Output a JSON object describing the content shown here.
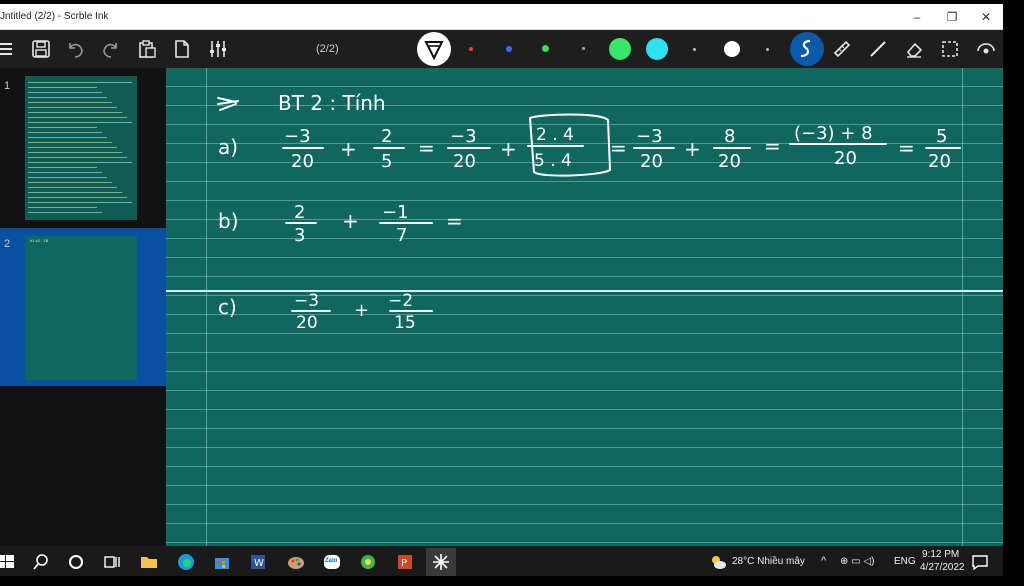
{
  "window": {
    "title": "Jntitled (2/2) - Scrble Ink",
    "minimize_glyph": "–",
    "restore_glyph": "❐",
    "close_glyph": "✕"
  },
  "toolbar": {
    "page_count": "(2/2)",
    "icons": [
      "menu-icon",
      "save-icon",
      "undo-icon",
      "redo-icon",
      "clipboard-icon",
      "new-page-icon",
      "settings-sliders-icon",
      "pen-mode-icon",
      "ruler-icon",
      "line-icon",
      "eraser-icon",
      "select-icon",
      "view-icon"
    ],
    "pen_colors": [
      "#ff3b3b",
      "#3b6bff",
      "#3be05a",
      "#aaaaaa",
      "#39e56a",
      "#2ee0f0",
      "#bbbbbb",
      "#ffffff",
      "#bbbbbb"
    ],
    "active_tool_color": "#0a5aa8"
  },
  "sidebar": {
    "pages": [
      {
        "number": "1"
      },
      {
        "number": "2",
        "selected": true
      }
    ],
    "thumb2_label": "b1  b2 : 1B"
  },
  "canvas": {
    "background": "#0f6760",
    "heading": "BT 2 : Tính",
    "a_label": "a)",
    "a_num1": "−3",
    "a_den1": "20",
    "a_op1": "+",
    "a_num2": "2",
    "a_den2": "5",
    "a_eq1": "=",
    "a_num3": "−3",
    "a_den3": "20",
    "a_op2": "+",
    "a_num4": "2 . 4",
    "a_den4": "5 . 4",
    "a_eq2": "=",
    "a_num5": "−3",
    "a_den5": "20",
    "a_op3": "+",
    "a_num6": "8",
    "a_den6": "20",
    "a_eq3": "=",
    "a_num7": "(−3) + 8",
    "a_den7": "20",
    "a_eq4": "=",
    "a_num8": "5",
    "a_den8": "20",
    "b_label": "b)",
    "b_num1": "2",
    "b_den1": "3",
    "b_op1": "+",
    "b_num2": "−1",
    "b_den2": "7",
    "b_eq1": "=",
    "c_label": "c)",
    "c_num1": "−3",
    "c_den1": "20",
    "c_op1": "+",
    "c_num2": "−2",
    "c_den2": "15"
  },
  "taskbar": {
    "apps": [
      "windows-icon",
      "search-icon",
      "cortana-icon",
      "task-view-icon",
      "file-explorer-icon",
      "edge-icon",
      "store-icon",
      "word-icon",
      "paint-icon",
      "zalo-icon",
      "app-icon",
      "powerpoint-icon",
      "scrble-ink-icon"
    ],
    "zalo_label": "Zalo",
    "weather": "28°C  Nhiều mây",
    "language": "ENG",
    "time": "9:12 PM",
    "date": "4/27/2022"
  }
}
